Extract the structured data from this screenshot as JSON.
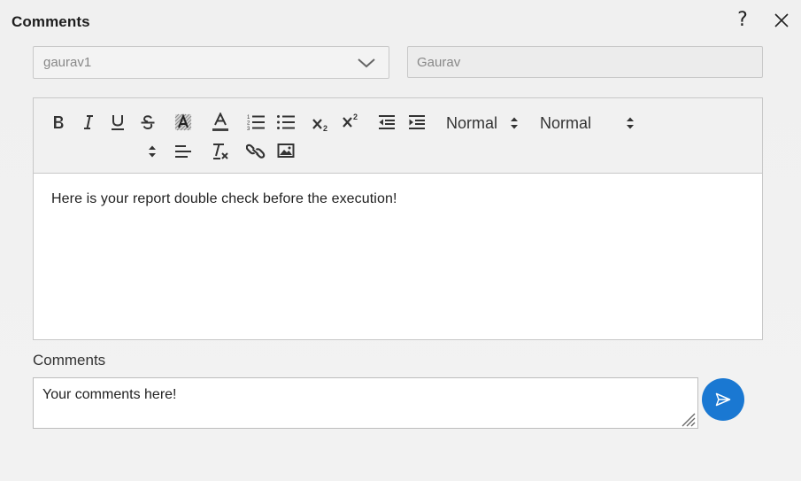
{
  "dialog": {
    "title": "Comments"
  },
  "user_select": {
    "selected": "gaurav1"
  },
  "name_field": {
    "value": "Gaurav"
  },
  "toolbar": {
    "font_dropdown": "Normal",
    "size_dropdown": "Normal",
    "buttons": [
      "bold",
      "italic",
      "underline",
      "strikethrough",
      "background-color",
      "text-color",
      "ordered-list",
      "bullet-list",
      "subscript",
      "superscript",
      "outdent",
      "indent",
      "align",
      "clear-formatting",
      "link",
      "image"
    ]
  },
  "editor": {
    "content": "Here is your report double check before the execution!"
  },
  "comments": {
    "label": "Comments",
    "value": "Your comments here!"
  },
  "colors": {
    "accent": "#1a78d2",
    "background": "#f0f0f0"
  }
}
